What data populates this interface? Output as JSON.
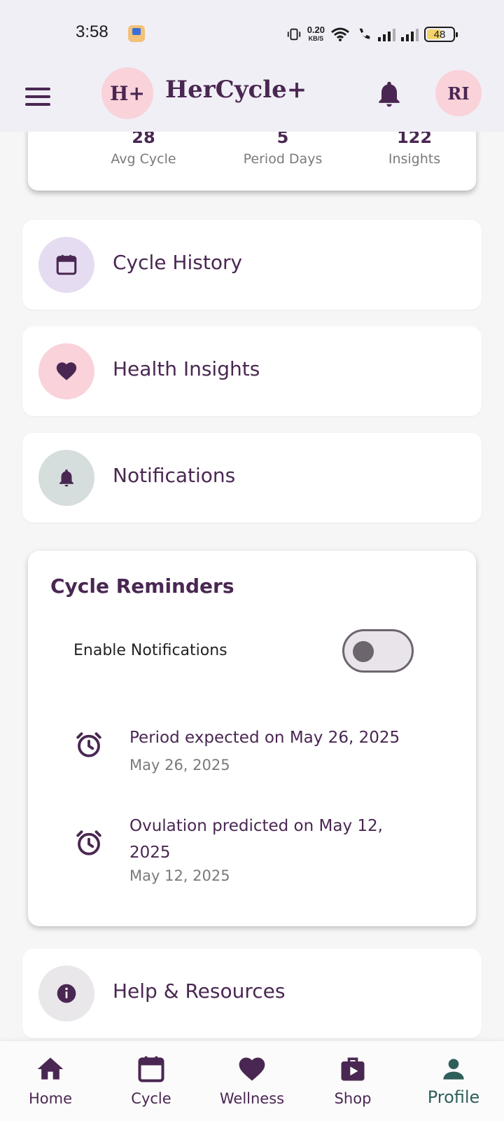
{
  "status_bar": {
    "time": "3:58",
    "net_speed": "0.20",
    "net_unit": "KB/S",
    "battery": "48"
  },
  "app_bar": {
    "logo_text": "H+",
    "title": "HerCycle+",
    "avatar_initials": "RI",
    "menu_icon": "hamburger-menu-icon",
    "bell_icon": "bell-icon"
  },
  "stats": [
    {
      "value": "28",
      "label": "Avg Cycle"
    },
    {
      "value": "5",
      "label": "Period Days"
    },
    {
      "value": "122",
      "label": "Insights"
    }
  ],
  "menu": [
    {
      "label": "Cycle History",
      "icon": "calendar-icon",
      "bg": "#e6dcf1"
    },
    {
      "label": "Health Insights",
      "icon": "heart-icon",
      "bg": "#f9d2da"
    },
    {
      "label": "Notifications",
      "icon": "bell-icon",
      "bg": "#d6dedd"
    }
  ],
  "reminders": {
    "title": "Cycle Reminders",
    "toggle_label": "Enable Notifications",
    "toggle_on": false,
    "items": [
      {
        "text": "Period expected on May 26, 2025",
        "date": "May 26, 2025"
      },
      {
        "text": "Ovulation predicted on May 12, 2025",
        "date": "May 12, 2025"
      }
    ]
  },
  "help": {
    "label": "Help & Resources",
    "icon": "info-icon",
    "bg": "#e9e7ea"
  },
  "nav": [
    {
      "label": "Home",
      "icon": "home-icon"
    },
    {
      "label": "Cycle",
      "icon": "calendar-icon"
    },
    {
      "label": "Wellness",
      "icon": "heart-icon"
    },
    {
      "label": "Shop",
      "icon": "shopping-bag-icon"
    },
    {
      "label": "Profile",
      "icon": "person-icon",
      "active": true
    }
  ],
  "colors": {
    "primary": "#4a2752",
    "accent_pink": "#f9d2da",
    "active_nav": "#2f5f5a"
  }
}
